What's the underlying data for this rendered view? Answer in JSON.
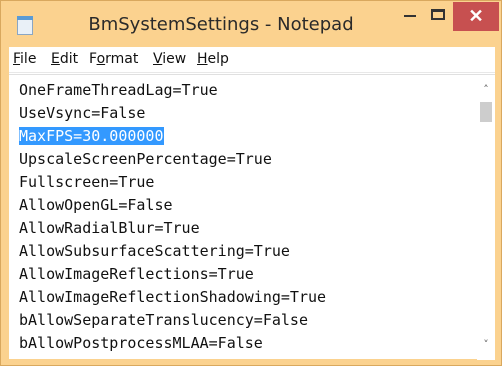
{
  "window": {
    "title": "BmSystemSettings - Notepad",
    "close_glyph": "✕"
  },
  "menu": [
    {
      "label": "File",
      "accel": "F",
      "rest": "ile"
    },
    {
      "label": "Edit",
      "accel": "E",
      "rest": "dit"
    },
    {
      "label": "Format",
      "pre": "F",
      "accel": "o",
      "rest": "rmat"
    },
    {
      "label": "View",
      "accel": "V",
      "rest": "iew"
    },
    {
      "label": "Help",
      "accel": "H",
      "rest": "elp"
    }
  ],
  "editor": {
    "selected_line_index": 2,
    "lines": [
      "OneFrameThreadLag=True",
      "UseVsync=False",
      "MaxFPS=30.000000",
      "UpscaleScreenPercentage=True",
      "Fullscreen=True",
      "AllowOpenGL=False",
      "AllowRadialBlur=True",
      "AllowSubsurfaceScattering=True",
      "AllowImageReflections=True",
      "AllowImageReflectionShadowing=True",
      "bAllowSeparateTranslucency=False",
      "bAllowPostprocessMLAA=False"
    ]
  },
  "colors": {
    "titlebar": "#fbd28f",
    "close_button": "#c75050",
    "selection": "#3399ff"
  }
}
